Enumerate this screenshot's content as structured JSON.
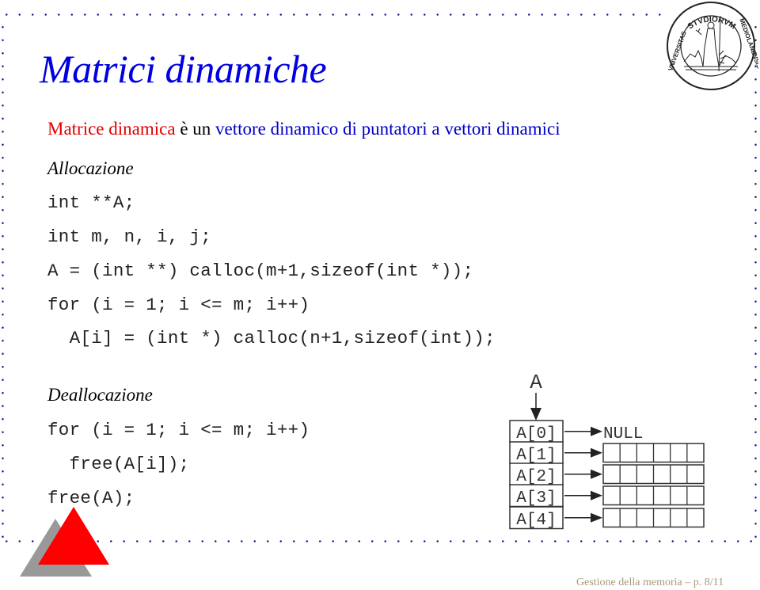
{
  "slide": {
    "title": "Matrici dinamiche",
    "subtitle": {
      "part1": "Matrice dinamica",
      "part2": " è un ",
      "part3": "vettore dinamico di puntatori a vettori dinamici"
    },
    "allocation": {
      "heading": "Allocazione",
      "code_lines": [
        "int **A;",
        "int m, n, i, j;",
        "A = (int **) calloc(m+1,sizeof(int *));",
        "for (i = 1; i <= m; i++)",
        "  A[i] = (int *) calloc(n+1,sizeof(int));"
      ]
    },
    "deallocation": {
      "heading": "Deallocazione",
      "code_lines": [
        "for (i = 1; i <= m; i++)",
        "  free(A[i]);",
        "free(A);"
      ]
    },
    "diagram": {
      "pointer_label": "A",
      "rows": [
        "A[0]",
        "A[1]",
        "A[2]",
        "A[3]",
        "A[4]"
      ],
      "null_label": "NULL",
      "cells_per_row": 6
    },
    "logo": {
      "top_text": "STVDIORVM",
      "left_text": "VNIVERSITAS",
      "right_text": "MEDIOLANENSIS"
    },
    "footer": "Gestione della memoria – p. 8/11"
  },
  "colors": {
    "title": "#0000e0",
    "highlight_red": "#e00000",
    "highlight_blue": "#0000c8",
    "border_dots": "#1a1a8c",
    "footer": "#a89a7a"
  }
}
